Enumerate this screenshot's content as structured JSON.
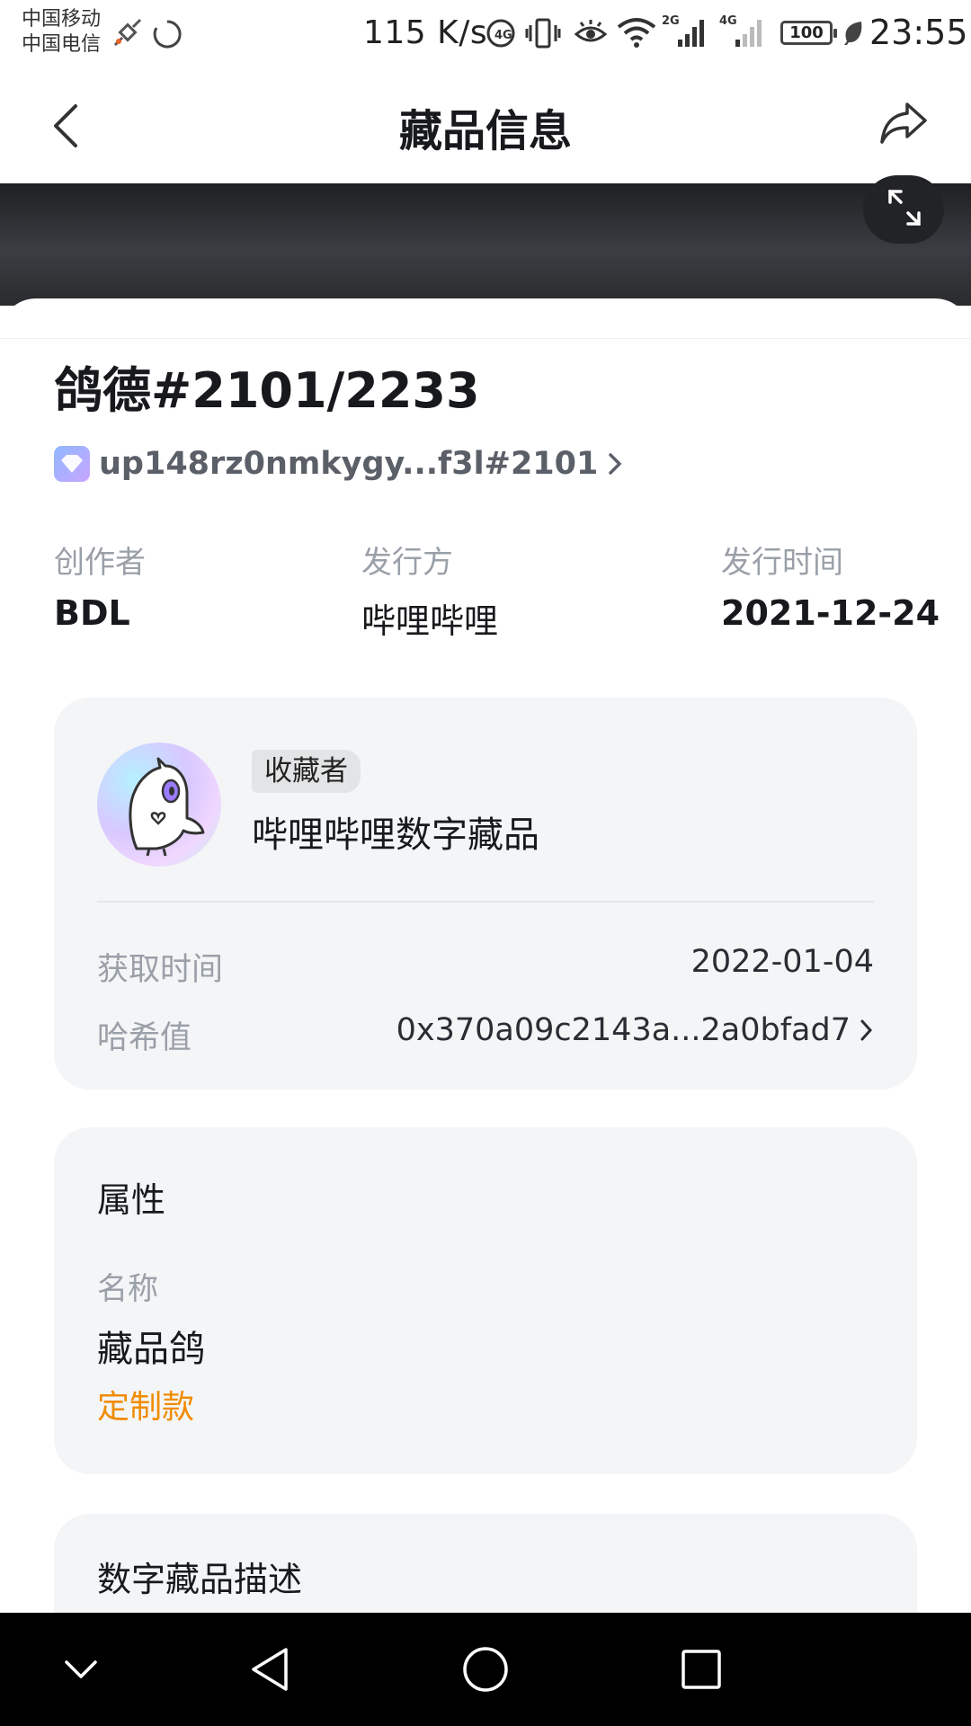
{
  "status_bar": {
    "carrier_1": "中国移动",
    "carrier_2": "中国电信",
    "net_speed": "115 K/s",
    "net_2g": "2G",
    "net_4g": "4G",
    "battery": "100",
    "time": "23:55"
  },
  "nav": {
    "title": "藏品信息",
    "back_icon": "chevron-left-icon",
    "share_icon": "share-icon"
  },
  "banner": {
    "expand_icon": "expand-icon"
  },
  "item": {
    "title": "鸽德#2101/2233",
    "chain_address": "up148rz0nmkygy...f3l#2101",
    "creator_label": "创作者",
    "creator_value": "BDL",
    "issuer_label": "发行方",
    "issuer_value": "哔哩哔哩",
    "issue_date_label": "发行时间",
    "issue_date_value": "2021-12-24"
  },
  "owner": {
    "tag": "收藏者",
    "name": "哔哩哔哩数字藏品",
    "acquired_label": "获取时间",
    "acquired_value": "2022-01-04",
    "hash_label": "哈希值",
    "hash_value": "0x370a09c2143a...2a0bfad7"
  },
  "attributes": {
    "section_title": "属性",
    "name_label": "名称",
    "name_value": "藏品鸽",
    "tag": "定制款"
  },
  "description": {
    "section_title": "数字藏品描述"
  },
  "colors": {
    "accent_orange": "#f08c00",
    "card_bg": "#f4f5f7",
    "muted_text": "#9aa0a8"
  }
}
